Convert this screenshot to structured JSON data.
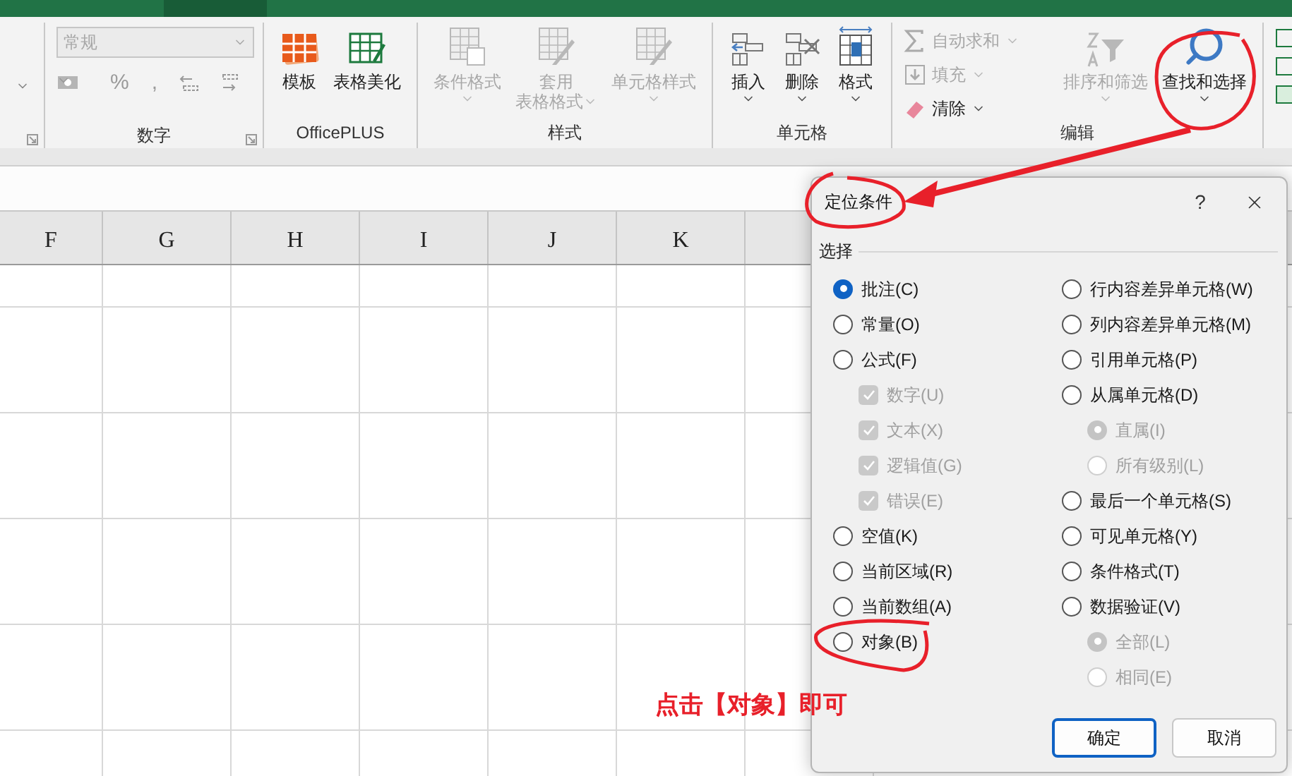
{
  "ribbon": {
    "number_group": {
      "label": "数字",
      "format_value": "常规",
      "symbols": [
        "%",
        ","
      ]
    },
    "groups": [
      {
        "label": "OfficePLUS",
        "items": [
          {
            "label": "模板",
            "kind": "large",
            "disabled": false,
            "caret": false
          },
          {
            "label": "表格美化",
            "kind": "large",
            "disabled": false,
            "caret": false
          }
        ]
      },
      {
        "label": "样式",
        "items": [
          {
            "label": "条件格式",
            "kind": "large",
            "disabled": true,
            "caret": true
          },
          {
            "lines": [
              "套用",
              "表格格式"
            ],
            "kind": "large",
            "disabled": true,
            "caret": true
          },
          {
            "label": "单元格样式",
            "kind": "large",
            "disabled": true,
            "caret": true
          }
        ]
      },
      {
        "label": "单元格",
        "items": [
          {
            "label": "插入",
            "kind": "large",
            "disabled": false,
            "caret": true
          },
          {
            "label": "删除",
            "kind": "large",
            "disabled": false,
            "caret": true
          },
          {
            "label": "格式",
            "kind": "large",
            "disabled": false,
            "caret": true
          }
        ]
      },
      {
        "label": "编辑",
        "items": [
          {
            "label": "自动求和",
            "kind": "small",
            "disabled": true,
            "caret": true
          },
          {
            "label": "填充",
            "kind": "small",
            "disabled": true,
            "caret": true
          },
          {
            "label": "清除",
            "kind": "small",
            "disabled": false,
            "caret": true
          },
          {
            "label": "排序和筛选",
            "kind": "large",
            "disabled": true,
            "caret": true
          },
          {
            "label": "查找和选择",
            "kind": "large",
            "disabled": false,
            "caret": true
          }
        ]
      }
    ]
  },
  "sheet": {
    "columns": [
      "F",
      "G",
      "H",
      "I",
      "J",
      "K"
    ]
  },
  "dialog": {
    "title": "定位条件",
    "help": "?",
    "group_label": "选择",
    "left": [
      {
        "label": "批注(C)",
        "kind": "radio",
        "selected": true,
        "disabled": false
      },
      {
        "label": "常量(O)",
        "kind": "radio",
        "selected": false,
        "disabled": false
      },
      {
        "label": "公式(F)",
        "kind": "radio",
        "selected": false,
        "disabled": false,
        "children": [
          {
            "label": "数字(U)",
            "kind": "checkbox",
            "checked": true,
            "disabled": true
          },
          {
            "label": "文本(X)",
            "kind": "checkbox",
            "checked": true,
            "disabled": true
          },
          {
            "label": "逻辑值(G)",
            "kind": "checkbox",
            "checked": true,
            "disabled": true
          },
          {
            "label": "错误(E)",
            "kind": "checkbox",
            "checked": true,
            "disabled": true
          }
        ]
      },
      {
        "label": "空值(K)",
        "kind": "radio",
        "selected": false,
        "disabled": false
      },
      {
        "label": "当前区域(R)",
        "kind": "radio",
        "selected": false,
        "disabled": false
      },
      {
        "label": "当前数组(A)",
        "kind": "radio",
        "selected": false,
        "disabled": false
      },
      {
        "label": "对象(B)",
        "kind": "radio",
        "selected": false,
        "disabled": false
      }
    ],
    "right": [
      {
        "label": "行内容差异单元格(W)",
        "kind": "radio",
        "selected": false,
        "disabled": false
      },
      {
        "label": "列内容差异单元格(M)",
        "kind": "radio",
        "selected": false,
        "disabled": false
      },
      {
        "label": "引用单元格(P)",
        "kind": "radio",
        "selected": false,
        "disabled": false
      },
      {
        "label": "从属单元格(D)",
        "kind": "radio",
        "selected": false,
        "disabled": false,
        "children": [
          {
            "label": "直属(I)",
            "kind": "radio",
            "selected": true,
            "disabled": true
          },
          {
            "label": "所有级别(L)",
            "kind": "radio",
            "selected": false,
            "disabled": true
          }
        ]
      },
      {
        "label": "最后一个单元格(S)",
        "kind": "radio",
        "selected": false,
        "disabled": false
      },
      {
        "label": "可见单元格(Y)",
        "kind": "radio",
        "selected": false,
        "disabled": false
      },
      {
        "label": "条件格式(T)",
        "kind": "radio",
        "selected": false,
        "disabled": false
      },
      {
        "label": "数据验证(V)",
        "kind": "radio",
        "selected": false,
        "disabled": false,
        "children": [
          {
            "label": "全部(L)",
            "kind": "radio",
            "selected": true,
            "disabled": true
          },
          {
            "label": "相同(E)",
            "kind": "radio",
            "selected": false,
            "disabled": true
          }
        ]
      }
    ],
    "buttons": [
      {
        "label": "确定",
        "primary": true
      },
      {
        "label": "取消",
        "primary": false
      }
    ]
  },
  "annotation": {
    "text": "点击【对象】即可"
  }
}
